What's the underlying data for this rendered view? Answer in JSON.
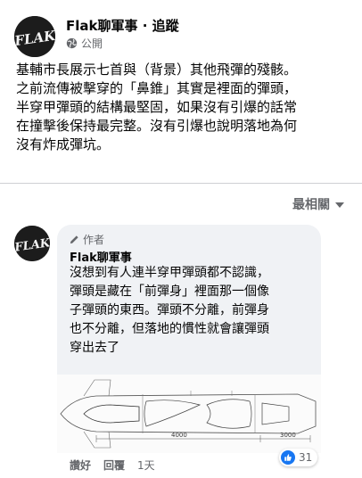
{
  "post": {
    "page_name": "Flak聊軍事",
    "separator": " · ",
    "follow_label": "追蹤",
    "privacy_label": "公開",
    "avatar_text": "FLAK",
    "text_lines": [
      "基輔市長展示七首與（背景）其他飛彈的殘骸。",
      "之前流傳被擊穿的「鼻錐」其實是裡面的彈頭，",
      "半穿甲彈頭的結構最堅固，如果沒有引爆的話常",
      "在撞擊後保持最完整。沒有引爆也說明落地為何",
      "沒有炸成彈坑。"
    ]
  },
  "comments_header": {
    "sort_label": "最相關"
  },
  "comment": {
    "author_tag": "作者",
    "author": "Flak聊軍事",
    "text_lines": [
      "沒想到有人連半穿甲彈頭都不認識，",
      "彈頭是藏在「前彈身」裡面那一個像",
      "子彈頭的東西。彈頭不分離，前彈身",
      "也不分離，但落地的慣性就會讓彈頭",
      "穿出去了"
    ],
    "diagram_labels": [
      "4000",
      "3000"
    ],
    "actions": {
      "like": "讚好",
      "reply": "回覆",
      "time": "1天"
    },
    "reaction_count": "31"
  },
  "colors": {
    "accent": "#1877f2",
    "secondary_text": "#65676b",
    "bubble": "#f0f2f5"
  },
  "icons": [
    "globe-icon",
    "pencil-icon",
    "like-icon",
    "chevron-down-icon"
  ]
}
